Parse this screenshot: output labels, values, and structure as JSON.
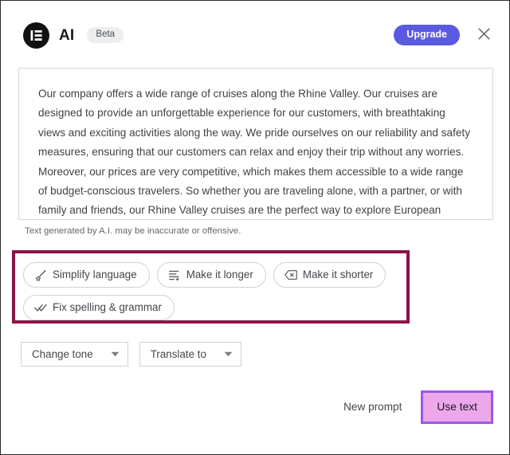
{
  "window": {
    "title": "AI",
    "badge": "Beta"
  },
  "header": {
    "logo_icon": "elementor-logo-icon",
    "upgrade_label": "Upgrade",
    "close_icon": "close-icon",
    "upgrade_color": "#5a5ae0",
    "badge_bg": "#eceef0"
  },
  "generated": {
    "text": "Our company offers a wide range of cruises along the Rhine Valley. Our cruises are designed to provide an unforgettable experience for our customers, with breathtaking views and exciting activities along the way. We pride ourselves on our reliability and safety measures, ensuring that our customers can relax and enjoy their trip without any worries. Moreover, our prices are very competitive, which makes them accessible to a wide range of budget-conscious travelers. So whether you are traveling alone, with a partner, or with family and friends, our Rhine Valley cruises are the perfect way to explore European beauty in a comfortable and affordable way.",
    "disclaimer": "Text generated by A.I. may be inaccurate or offensive."
  },
  "quick_actions": {
    "highlight_color": "#8c1448",
    "items": [
      {
        "label": "Simplify language",
        "icon": "magic-wand-icon"
      },
      {
        "label": "Make it longer",
        "icon": "add-lines-icon"
      },
      {
        "label": "Make it shorter",
        "icon": "backspace-icon"
      },
      {
        "label": "Fix spelling & grammar",
        "icon": "double-check-icon"
      }
    ]
  },
  "dropdowns": [
    {
      "label": "Change tone",
      "icon": "chevron-down-icon"
    },
    {
      "label": "Translate to",
      "icon": "chevron-down-icon"
    }
  ],
  "footer": {
    "new_prompt_label": "New prompt",
    "use_text_label": "Use text",
    "use_text_highlight_border": "#9a5ae6",
    "use_text_highlight_fill": "#eda8ec"
  }
}
